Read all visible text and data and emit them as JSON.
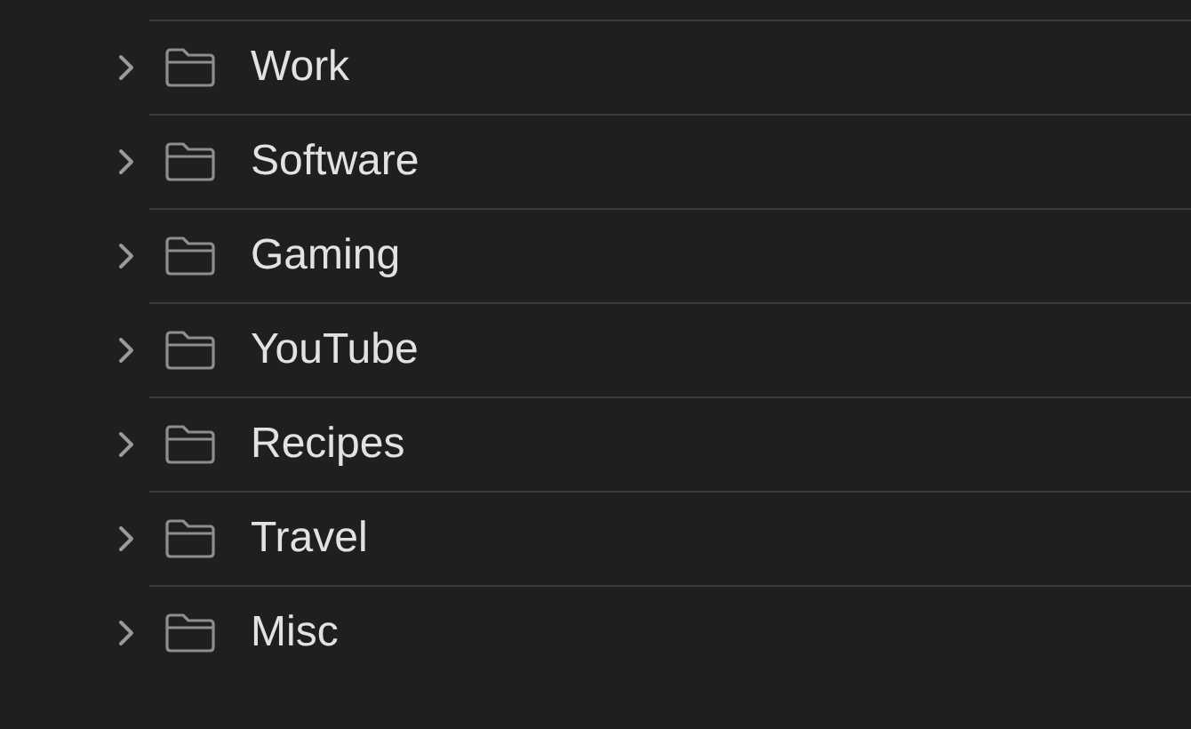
{
  "folders": [
    {
      "name": "Work",
      "expanded": false
    },
    {
      "name": "Software",
      "expanded": false
    },
    {
      "name": "Gaming",
      "expanded": false
    },
    {
      "name": "YouTube",
      "expanded": false
    },
    {
      "name": "Recipes",
      "expanded": false
    },
    {
      "name": "Travel",
      "expanded": false
    },
    {
      "name": "Misc",
      "expanded": false
    }
  ]
}
